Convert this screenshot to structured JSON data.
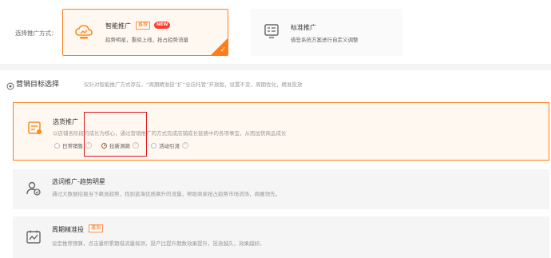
{
  "promo_method": {
    "label": "选择推广方式：",
    "smart": {
      "title": "智能推广",
      "tag_recommend": "推荐",
      "tag_new": "NEW",
      "desc": "趋势明星，重磅上线，抢占趋势流量"
    },
    "standard": {
      "title": "标准推广",
      "desc": "借签系统方案进行自定义调整"
    }
  },
  "goal_section": {
    "title": "营销目标选择",
    "note": "仅针对智能推广方式存在，“周期精准投”扩“全店托管”开放版，设置不变，周期优化，精准投放",
    "options": [
      {
        "title": "选货推广",
        "desc": "以店铺各阶段的成长为核心，通过营销推广的方式完成店铺成长链路中的各项事宜，从而加快商品成长",
        "radios": [
          {
            "label": "日常销售",
            "selected": false
          },
          {
            "label": "拉新测款",
            "selected": true
          },
          {
            "label": "活动引流",
            "selected": false
          }
        ]
      },
      {
        "title": "选词推广-趋势明星",
        "desc": "通过大数据挖掘当下飙涨趋势，找到蓝海优质飙升的流量，帮助商家抢占趋势市场流场，商圈领先。"
      },
      {
        "title": "周期精准投",
        "tag": "邀测",
        "desc": "设定推荐预算，点击量积累期借流量探测，投产比提升期数效果提升，投放越久，效果越好。"
      }
    ]
  },
  "colors": {
    "accent": "#ff7d1a",
    "highlight_box": "#e0151b",
    "radio_selected": "#8b6a3c"
  }
}
